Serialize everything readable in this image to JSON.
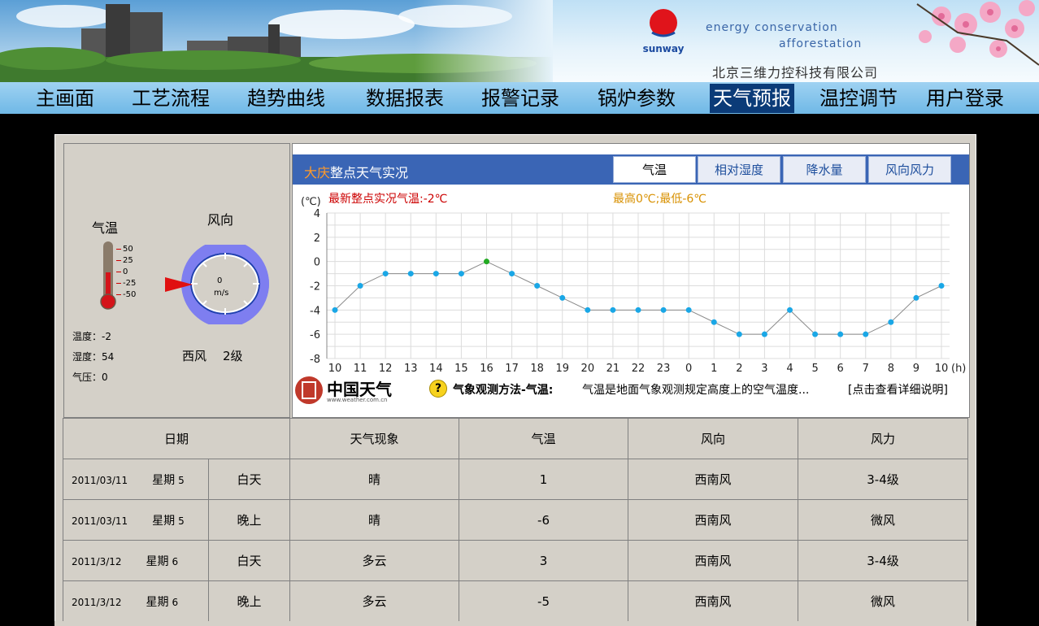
{
  "banner": {
    "tagline_line1": "energy conservation",
    "tagline_line2": "afforestation",
    "logo_text": "sunway",
    "company": "北京三维力控科技有限公司"
  },
  "nav": {
    "items": [
      {
        "label": "主画面"
      },
      {
        "label": "工艺流程"
      },
      {
        "label": "趋势曲线"
      },
      {
        "label": "数据报表"
      },
      {
        "label": "报警记录"
      },
      {
        "label": "锅炉参数"
      },
      {
        "label": "天气预报"
      },
      {
        "label": "温控调节"
      },
      {
        "label": "用户登录"
      }
    ],
    "active_index": 6
  },
  "left_panel": {
    "thermometer_title": "气温",
    "wind_title": "风向",
    "thermo_scale": [
      "50",
      "25",
      "0",
      "-25",
      "-50"
    ],
    "wind_speed_value": "0",
    "wind_speed_unit": "m/s",
    "temperature_label": "温度：-2",
    "humidity_label": "湿度：54",
    "pressure_label": "气压：0",
    "wind_dir_text": "西风",
    "wind_level_text": "2级"
  },
  "chart_panel": {
    "city": "大庆",
    "title_suffix": "整点天气实况",
    "tabs": [
      "气温",
      "相对湿度",
      "降水量",
      "风向风力"
    ],
    "active_tab": 0,
    "latest_text": "最新整点实况气温:-2℃",
    "range_text": "最高0℃;最低-6℃",
    "colors": {
      "latest": "#cc0000",
      "range": "#d89000",
      "point": "#1aa7e6",
      "highlight": "#22aa22",
      "header": "#3a65b5"
    }
  },
  "chart_data": {
    "type": "line",
    "ylabel": "(℃)",
    "xlabel": "(h)",
    "ylim": [
      -8,
      4
    ],
    "yticks": [
      4,
      2,
      0,
      -2,
      -4,
      -6,
      -8
    ],
    "grid": true,
    "x": [
      "10",
      "11",
      "12",
      "13",
      "14",
      "15",
      "16",
      "17",
      "18",
      "19",
      "20",
      "21",
      "22",
      "23",
      "0",
      "1",
      "2",
      "3",
      "4",
      "5",
      "6",
      "7",
      "8",
      "9",
      "10"
    ],
    "series": [
      {
        "values": [
          -4,
          -2,
          -1,
          -1,
          -1,
          -1,
          0,
          -1,
          -2,
          -3,
          -4,
          -4,
          -4,
          -4,
          -4,
          -5,
          -6,
          -6,
          -4,
          -6,
          -6,
          -6,
          -5,
          -3,
          -2
        ],
        "highlight_index": 6
      }
    ]
  },
  "footer": {
    "brand": "中国天气",
    "url": "www.weather.com.cn",
    "q_icon": "?",
    "method_title": "气象观测方法-气温:",
    "method_text": "气温是地面气象观测规定高度上的空气温度...",
    "detail_link": "[点击查看详细说明]"
  },
  "table": {
    "headers": [
      "日期",
      "天气现象",
      "气温",
      "风向",
      "风力"
    ],
    "rows": [
      {
        "date": "2011/03/11",
        "weekday": "星期",
        "weekday_num": "5",
        "period": "白天",
        "weather": "晴",
        "temp": "1",
        "wind_dir": "西南风",
        "wind_force": "3-4级"
      },
      {
        "date": "2011/03/11",
        "weekday": "星期",
        "weekday_num": "5",
        "period": "晚上",
        "weather": "晴",
        "temp": "-6",
        "wind_dir": "西南风",
        "wind_force": "微风"
      },
      {
        "date": "2011/3/12",
        "weekday": "星期",
        "weekday_num": "6",
        "period": "白天",
        "weather": "多云",
        "temp": "3",
        "wind_dir": "西南风",
        "wind_force": "3-4级"
      },
      {
        "date": "2011/3/12",
        "weekday": "星期",
        "weekday_num": "6",
        "period": "晚上",
        "weather": "多云",
        "temp": "-5",
        "wind_dir": "西南风",
        "wind_force": "微风"
      }
    ]
  }
}
